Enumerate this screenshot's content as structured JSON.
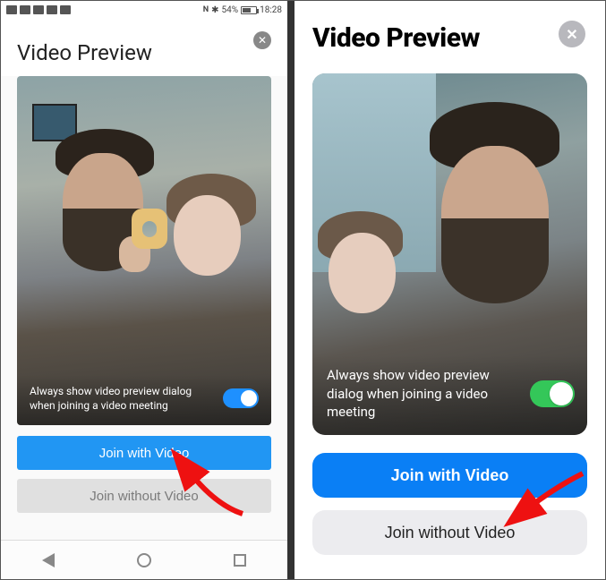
{
  "statusbar": {
    "time": "18:28",
    "battery_pct": "54%",
    "icons_left": [
      "hd-icon",
      "wifi-icon",
      "signal-icon",
      "video-icon",
      "hd2-icon"
    ],
    "icons_right": [
      "nfc-icon",
      "bluetooth-icon"
    ]
  },
  "left": {
    "title": "Video Preview",
    "overlay_text": "Always show video preview dialog when joining a video meeting",
    "toggle_on": true,
    "join_with": "Join with Video",
    "join_without": "Join without Video"
  },
  "right": {
    "title": "Video Preview",
    "overlay_text": "Always show video preview dialog when joining a video meeting",
    "toggle_on": true,
    "join_with": "Join with Video",
    "join_without": "Join without Video"
  },
  "navbar": {
    "back": "back",
    "home": "home",
    "recents": "recents"
  },
  "colors": {
    "android_accent": "#2196f3",
    "ios_accent": "#0a7ff5",
    "ios_toggle": "#34c759"
  }
}
